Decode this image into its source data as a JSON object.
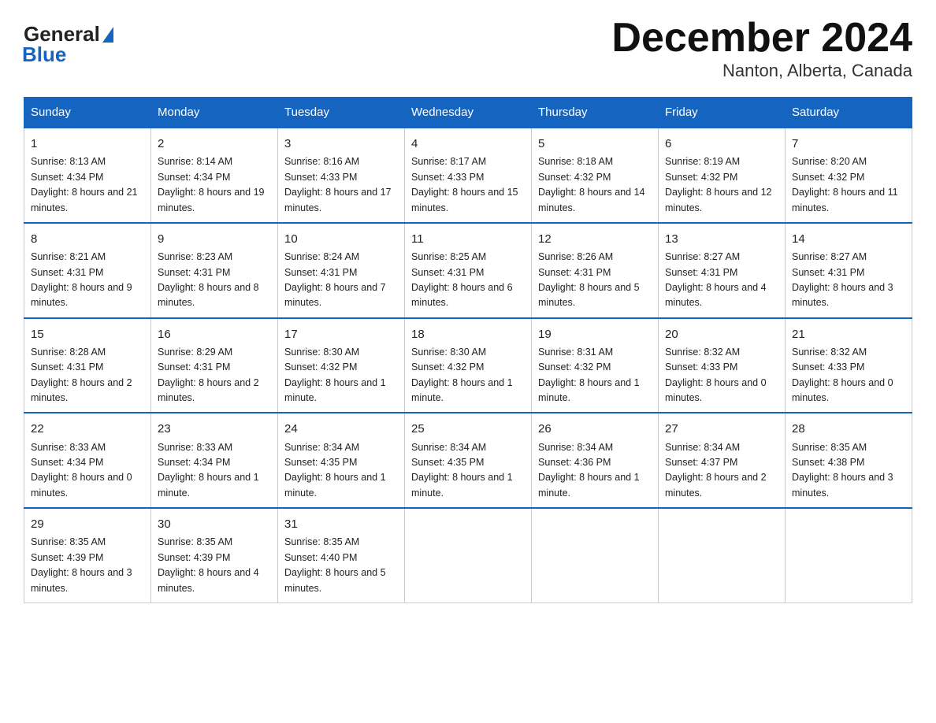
{
  "header": {
    "logo_general": "General",
    "logo_blue": "Blue",
    "title": "December 2024",
    "subtitle": "Nanton, Alberta, Canada"
  },
  "days_of_week": [
    "Sunday",
    "Monday",
    "Tuesday",
    "Wednesday",
    "Thursday",
    "Friday",
    "Saturday"
  ],
  "weeks": [
    [
      {
        "day": "1",
        "sunrise": "8:13 AM",
        "sunset": "4:34 PM",
        "daylight": "8 hours and 21 minutes."
      },
      {
        "day": "2",
        "sunrise": "8:14 AM",
        "sunset": "4:34 PM",
        "daylight": "8 hours and 19 minutes."
      },
      {
        "day": "3",
        "sunrise": "8:16 AM",
        "sunset": "4:33 PM",
        "daylight": "8 hours and 17 minutes."
      },
      {
        "day": "4",
        "sunrise": "8:17 AM",
        "sunset": "4:33 PM",
        "daylight": "8 hours and 15 minutes."
      },
      {
        "day": "5",
        "sunrise": "8:18 AM",
        "sunset": "4:32 PM",
        "daylight": "8 hours and 14 minutes."
      },
      {
        "day": "6",
        "sunrise": "8:19 AM",
        "sunset": "4:32 PM",
        "daylight": "8 hours and 12 minutes."
      },
      {
        "day": "7",
        "sunrise": "8:20 AM",
        "sunset": "4:32 PM",
        "daylight": "8 hours and 11 minutes."
      }
    ],
    [
      {
        "day": "8",
        "sunrise": "8:21 AM",
        "sunset": "4:31 PM",
        "daylight": "8 hours and 9 minutes."
      },
      {
        "day": "9",
        "sunrise": "8:23 AM",
        "sunset": "4:31 PM",
        "daylight": "8 hours and 8 minutes."
      },
      {
        "day": "10",
        "sunrise": "8:24 AM",
        "sunset": "4:31 PM",
        "daylight": "8 hours and 7 minutes."
      },
      {
        "day": "11",
        "sunrise": "8:25 AM",
        "sunset": "4:31 PM",
        "daylight": "8 hours and 6 minutes."
      },
      {
        "day": "12",
        "sunrise": "8:26 AM",
        "sunset": "4:31 PM",
        "daylight": "8 hours and 5 minutes."
      },
      {
        "day": "13",
        "sunrise": "8:27 AM",
        "sunset": "4:31 PM",
        "daylight": "8 hours and 4 minutes."
      },
      {
        "day": "14",
        "sunrise": "8:27 AM",
        "sunset": "4:31 PM",
        "daylight": "8 hours and 3 minutes."
      }
    ],
    [
      {
        "day": "15",
        "sunrise": "8:28 AM",
        "sunset": "4:31 PM",
        "daylight": "8 hours and 2 minutes."
      },
      {
        "day": "16",
        "sunrise": "8:29 AM",
        "sunset": "4:31 PM",
        "daylight": "8 hours and 2 minutes."
      },
      {
        "day": "17",
        "sunrise": "8:30 AM",
        "sunset": "4:32 PM",
        "daylight": "8 hours and 1 minute."
      },
      {
        "day": "18",
        "sunrise": "8:30 AM",
        "sunset": "4:32 PM",
        "daylight": "8 hours and 1 minute."
      },
      {
        "day": "19",
        "sunrise": "8:31 AM",
        "sunset": "4:32 PM",
        "daylight": "8 hours and 1 minute."
      },
      {
        "day": "20",
        "sunrise": "8:32 AM",
        "sunset": "4:33 PM",
        "daylight": "8 hours and 0 minutes."
      },
      {
        "day": "21",
        "sunrise": "8:32 AM",
        "sunset": "4:33 PM",
        "daylight": "8 hours and 0 minutes."
      }
    ],
    [
      {
        "day": "22",
        "sunrise": "8:33 AM",
        "sunset": "4:34 PM",
        "daylight": "8 hours and 0 minutes."
      },
      {
        "day": "23",
        "sunrise": "8:33 AM",
        "sunset": "4:34 PM",
        "daylight": "8 hours and 1 minute."
      },
      {
        "day": "24",
        "sunrise": "8:34 AM",
        "sunset": "4:35 PM",
        "daylight": "8 hours and 1 minute."
      },
      {
        "day": "25",
        "sunrise": "8:34 AM",
        "sunset": "4:35 PM",
        "daylight": "8 hours and 1 minute."
      },
      {
        "day": "26",
        "sunrise": "8:34 AM",
        "sunset": "4:36 PM",
        "daylight": "8 hours and 1 minute."
      },
      {
        "day": "27",
        "sunrise": "8:34 AM",
        "sunset": "4:37 PM",
        "daylight": "8 hours and 2 minutes."
      },
      {
        "day": "28",
        "sunrise": "8:35 AM",
        "sunset": "4:38 PM",
        "daylight": "8 hours and 3 minutes."
      }
    ],
    [
      {
        "day": "29",
        "sunrise": "8:35 AM",
        "sunset": "4:39 PM",
        "daylight": "8 hours and 3 minutes."
      },
      {
        "day": "30",
        "sunrise": "8:35 AM",
        "sunset": "4:39 PM",
        "daylight": "8 hours and 4 minutes."
      },
      {
        "day": "31",
        "sunrise": "8:35 AM",
        "sunset": "4:40 PM",
        "daylight": "8 hours and 5 minutes."
      },
      null,
      null,
      null,
      null
    ]
  ],
  "labels": {
    "sunrise": "Sunrise:",
    "sunset": "Sunset:",
    "daylight": "Daylight:"
  }
}
